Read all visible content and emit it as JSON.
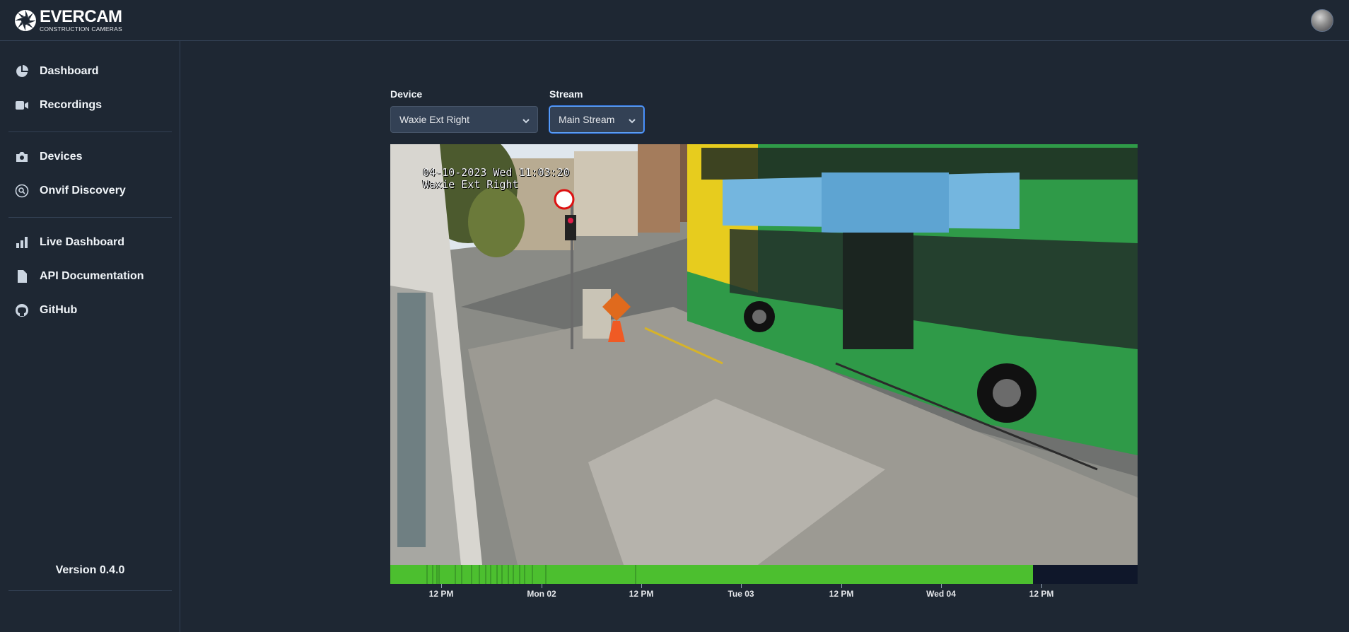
{
  "header": {
    "logo_title": "EVERCAM",
    "logo_subtitle": "CONSTRUCTION CAMERAS",
    "avatar_icon": "user-avatar-icon"
  },
  "sidebar": {
    "items": [
      {
        "label": "Dashboard",
        "icon": "pie-chart-icon"
      },
      {
        "label": "Recordings",
        "icon": "video-camera-icon"
      },
      {
        "label": "Devices",
        "icon": "camera-icon"
      },
      {
        "label": "Onvif Discovery",
        "icon": "search-circle-icon"
      },
      {
        "label": "Live Dashboard",
        "icon": "bar-chart-icon"
      },
      {
        "label": "API Documentation",
        "icon": "document-icon"
      },
      {
        "label": "GitHub",
        "icon": "github-icon"
      }
    ],
    "version": "Version 0.4.0"
  },
  "controls": {
    "device_label": "Device",
    "device_value": "Waxie Ext Right",
    "stream_label": "Stream",
    "stream_value": "Main Stream"
  },
  "video": {
    "osd_line1": "04-10-2023 Wed 11:03:20",
    "osd_line2": "Waxie Ext Right"
  },
  "timeline": {
    "recorded_fraction": 0.86,
    "fill_color": "#4cbf2f",
    "ticks": [
      "12 PM",
      "Mon 02",
      "12 PM",
      "Tue 03",
      "12 PM",
      "Wed 04",
      "12 PM"
    ]
  },
  "colors": {
    "background": "#1e2733",
    "accent": "#3b82f6",
    "timeline_recorded": "#4cbf2f"
  }
}
